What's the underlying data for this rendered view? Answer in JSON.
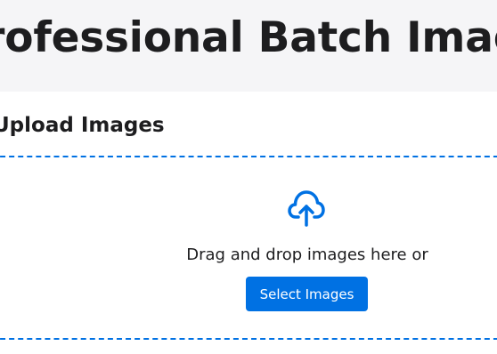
{
  "header": {
    "title": "Professional Batch Image Converter"
  },
  "upload": {
    "section_title": "Upload Images",
    "drop_text": "Drag and drop images here or",
    "select_button_label": "Select Images",
    "icon": "cloud-upload-icon"
  },
  "colors": {
    "accent": "#0071e3",
    "header_bg": "#f5f5f7",
    "text": "#1d1d1f"
  }
}
